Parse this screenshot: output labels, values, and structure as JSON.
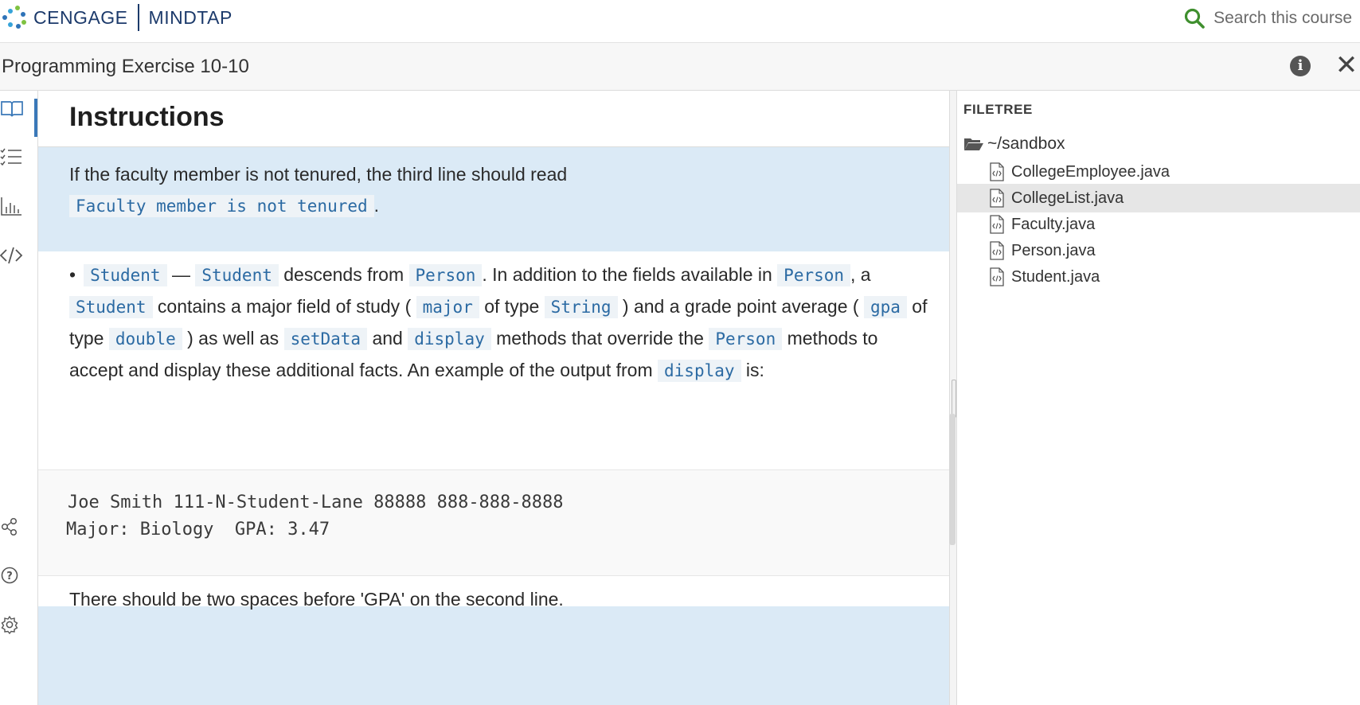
{
  "brand": {
    "name": "CENGAGE",
    "product": "MINDTAP"
  },
  "search": {
    "placeholder": "Search this course"
  },
  "page_title": "Programming Exercise 10-10",
  "instructions": {
    "heading": "Instructions",
    "callout1": {
      "line1": "If the faculty member is not tenured, the third line should read",
      "code": "Faculty member is not tenured",
      "tail": "."
    },
    "student_para": {
      "bullet": "•",
      "parts": [
        {
          "code": "Student"
        },
        {
          "text": " — "
        },
        {
          "code": "Student"
        },
        {
          "text": " descends from "
        },
        {
          "code": "Person"
        },
        {
          "text": ". In addition to the fields available in "
        },
        {
          "code": "Person"
        },
        {
          "text": ", a "
        },
        {
          "code": "Student"
        },
        {
          "text": " contains a major field of study ( "
        },
        {
          "code": "major"
        },
        {
          "text": " of type "
        },
        {
          "code": "String"
        },
        {
          "text": " ) and a grade point average ( "
        },
        {
          "code": "gpa"
        },
        {
          "text": " of type "
        },
        {
          "code": "double"
        },
        {
          "text": " ) as well as "
        },
        {
          "code": "setData"
        },
        {
          "text": " and "
        },
        {
          "code": "display"
        },
        {
          "text": " methods that override the "
        },
        {
          "code": "Person"
        },
        {
          "text": " methods to accept and display these additional facts. An example of the output from "
        },
        {
          "code": "display"
        },
        {
          "text": " is:"
        }
      ]
    },
    "sample_output": [
      "Joe Smith 111-N-Student-Lane 88888 888-888-8888",
      "Major: Biology  GPA: 3.47"
    ],
    "callout2": "There should be two spaces before 'GPA' on the second line."
  },
  "filetree": {
    "title": "FILETREE",
    "root": "~/sandbox",
    "files": [
      {
        "name": "CollegeEmployee.java",
        "selected": false
      },
      {
        "name": "CollegeList.java",
        "selected": true
      },
      {
        "name": "Faculty.java",
        "selected": false
      },
      {
        "name": "Person.java",
        "selected": false
      },
      {
        "name": "Student.java",
        "selected": false
      }
    ]
  },
  "rail_icons": [
    "book-icon",
    "checklist-icon",
    "bar-chart-icon",
    "code-icon",
    "share-icon",
    "help-icon",
    "settings-icon"
  ],
  "colors": {
    "accent": "#3a78b8",
    "callout_bg": "#dbeaf6",
    "code_text": "#2b6aa3",
    "brand": "#1c3a6b",
    "search_icon": "#3f8f2e"
  }
}
